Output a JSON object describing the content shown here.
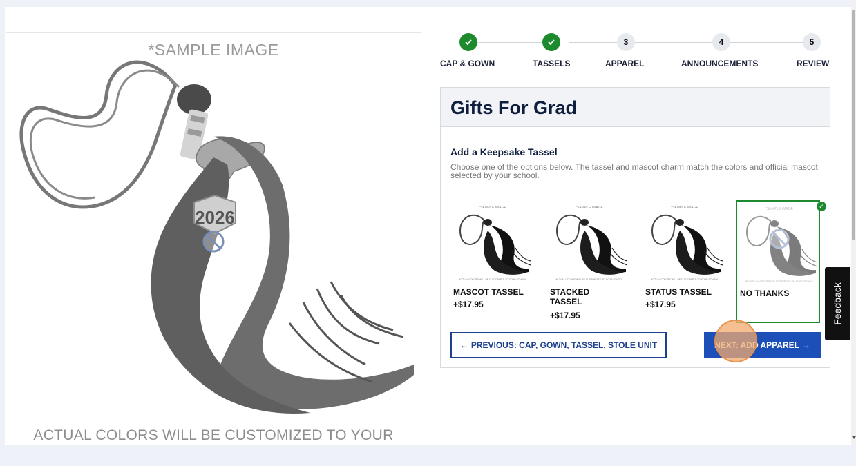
{
  "hero": {
    "top_caption": "*SAMPLE IMAGE",
    "bottom_caption": "ACTUAL COLORS WILL BE CUSTOMIZED TO YOUR SCHOOL",
    "year_charm": "2026"
  },
  "stepper": {
    "steps": [
      {
        "label": "CAP & GOWN",
        "status": "done",
        "number": "1",
        "icon": "check-icon"
      },
      {
        "label": "TASSELS",
        "status": "done",
        "number": "2",
        "icon": "check-icon"
      },
      {
        "label": "APPAREL",
        "status": "todo",
        "number": "3"
      },
      {
        "label": "ANNOUNCEMENTS",
        "status": "todo",
        "number": "4"
      },
      {
        "label": "REVIEW",
        "status": "todo",
        "number": "5"
      }
    ]
  },
  "panel": {
    "title": "Gifts For Grad",
    "section_title": "Add a Keepsake Tassel",
    "section_desc": "Choose one of the options below. The tassel and mascot charm match the colors and official mascot selected by your school.",
    "options": [
      {
        "name": "MASCOT TASSEL",
        "price": "+$17.95",
        "selected": false
      },
      {
        "name": "STACKED TASSEL",
        "price": "+$17.95",
        "selected": false
      },
      {
        "name": "STATUS TASSEL",
        "price": "+$17.95",
        "selected": false
      },
      {
        "name": "NO THANKS",
        "price": "",
        "selected": true
      }
    ],
    "thumb_top_caption": "*SAMPLE IMAGE",
    "thumb_bottom_caption": "ACTUAL COLORS WILL BE CUSTOMIZED TO YOUR SCHOOL"
  },
  "buttons": {
    "prev": "PREVIOUS: CAP, GOWN, TASSEL, STOLE UNIT",
    "prev_arrow": "←",
    "next": "NEXT: ADD APPAREL",
    "next_arrow": "→"
  },
  "feedback": {
    "label": "Feedback"
  },
  "colors": {
    "done": "#1e8a2e",
    "primary": "#1d4fb8",
    "title": "#0f1e3d",
    "background": "#eef2f8"
  }
}
